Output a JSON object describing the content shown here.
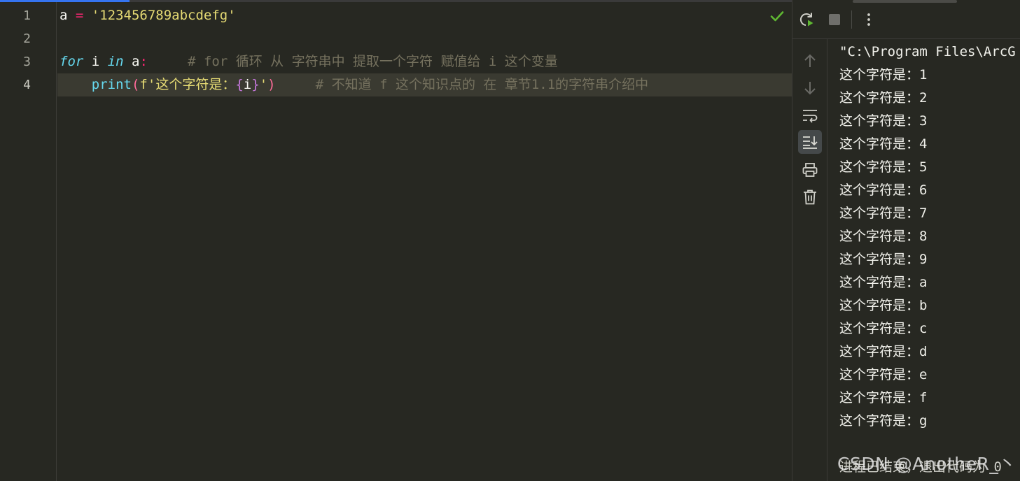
{
  "editor": {
    "line_numbers": [
      "1",
      "2",
      "3",
      "4"
    ],
    "line1": {
      "var": "a",
      "op": " = ",
      "str": "'123456789abcdefg'"
    },
    "line3": {
      "kw_for": "for",
      "var_i": " i ",
      "kw_in": "in",
      "var_a": " a",
      "colon": ":",
      "comment": "     # for 循环 从 字符串中 提取一个字符 赋值给 i 这个变量"
    },
    "line4": {
      "indent": "    ",
      "fn": "print",
      "lpar": "(",
      "fprefix": "f'",
      "text": "这个字符是：",
      "lbrace": "{",
      "ivar": "i",
      "rbrace": "}",
      "quote": "'",
      "rpar": ")",
      "comment": "     # 不知道 f 这个知识点的 在 章节1.1的字符串介绍中"
    }
  },
  "run": {
    "command": "\"C:\\Program Files\\ArcG",
    "prefix": "这个字符是：",
    "outputs": [
      "1",
      "2",
      "3",
      "4",
      "5",
      "6",
      "7",
      "8",
      "9",
      "a",
      "b",
      "c",
      "d",
      "e",
      "f",
      "g"
    ],
    "exit_text": "进程已结束，退出代码为 0"
  },
  "watermark": "CSDN @AnotheR_丶",
  "colors": {
    "accent": "#3574f0",
    "check": "#5fb832",
    "run": "#5fb832"
  }
}
